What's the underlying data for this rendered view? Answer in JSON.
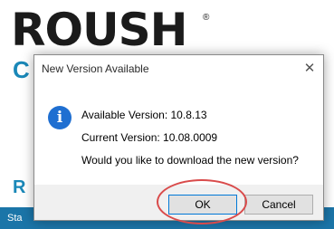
{
  "background": {
    "logo_text": "ROUSH",
    "logo_mark": "®",
    "partial_text_top": "C",
    "partial_text_bottom": "R",
    "status_text": "Sta"
  },
  "dialog": {
    "title": "New Version Available",
    "close_glyph": "✕",
    "icon_glyph": "i",
    "icon": "info-icon",
    "available_version": "Available Version: 10.8.13",
    "current_version": "Current Version: 10.08.0009",
    "question": "Would you like to download the new version?",
    "buttons": {
      "ok": "OK",
      "cancel": "Cancel"
    }
  },
  "colors": {
    "accent": "#1a88b8",
    "info_icon": "#1f6fd1",
    "highlight": "#d94b4b"
  }
}
